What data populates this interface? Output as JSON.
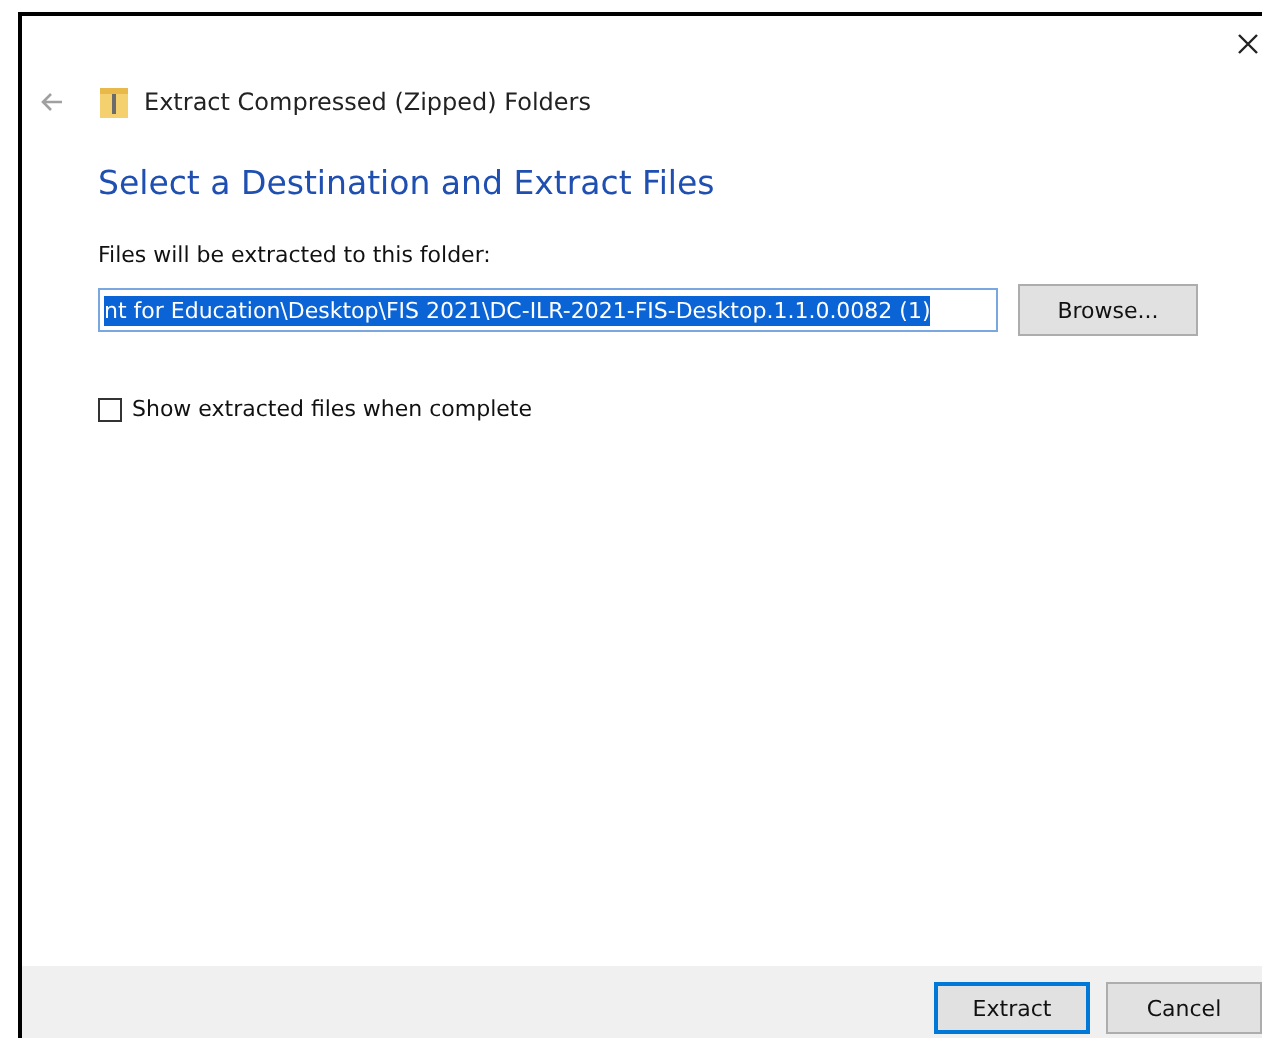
{
  "window": {
    "title": "Extract Compressed (Zipped) Folders"
  },
  "heading": "Select a Destination and Extract Files",
  "destination": {
    "label": "Files will be extracted to this folder:",
    "value": "nt for Education\\Desktop\\FIS 2021\\DC-ILR-2021-FIS-Desktop.1.1.0.0082 (1)",
    "value_selected": true,
    "browse": "Browse..."
  },
  "show_files": {
    "label": "Show extracted files when complete",
    "checked": false
  },
  "buttons": [
    {
      "label": "Extract",
      "default": true
    },
    {
      "label": "Cancel",
      "default": false
    }
  ]
}
